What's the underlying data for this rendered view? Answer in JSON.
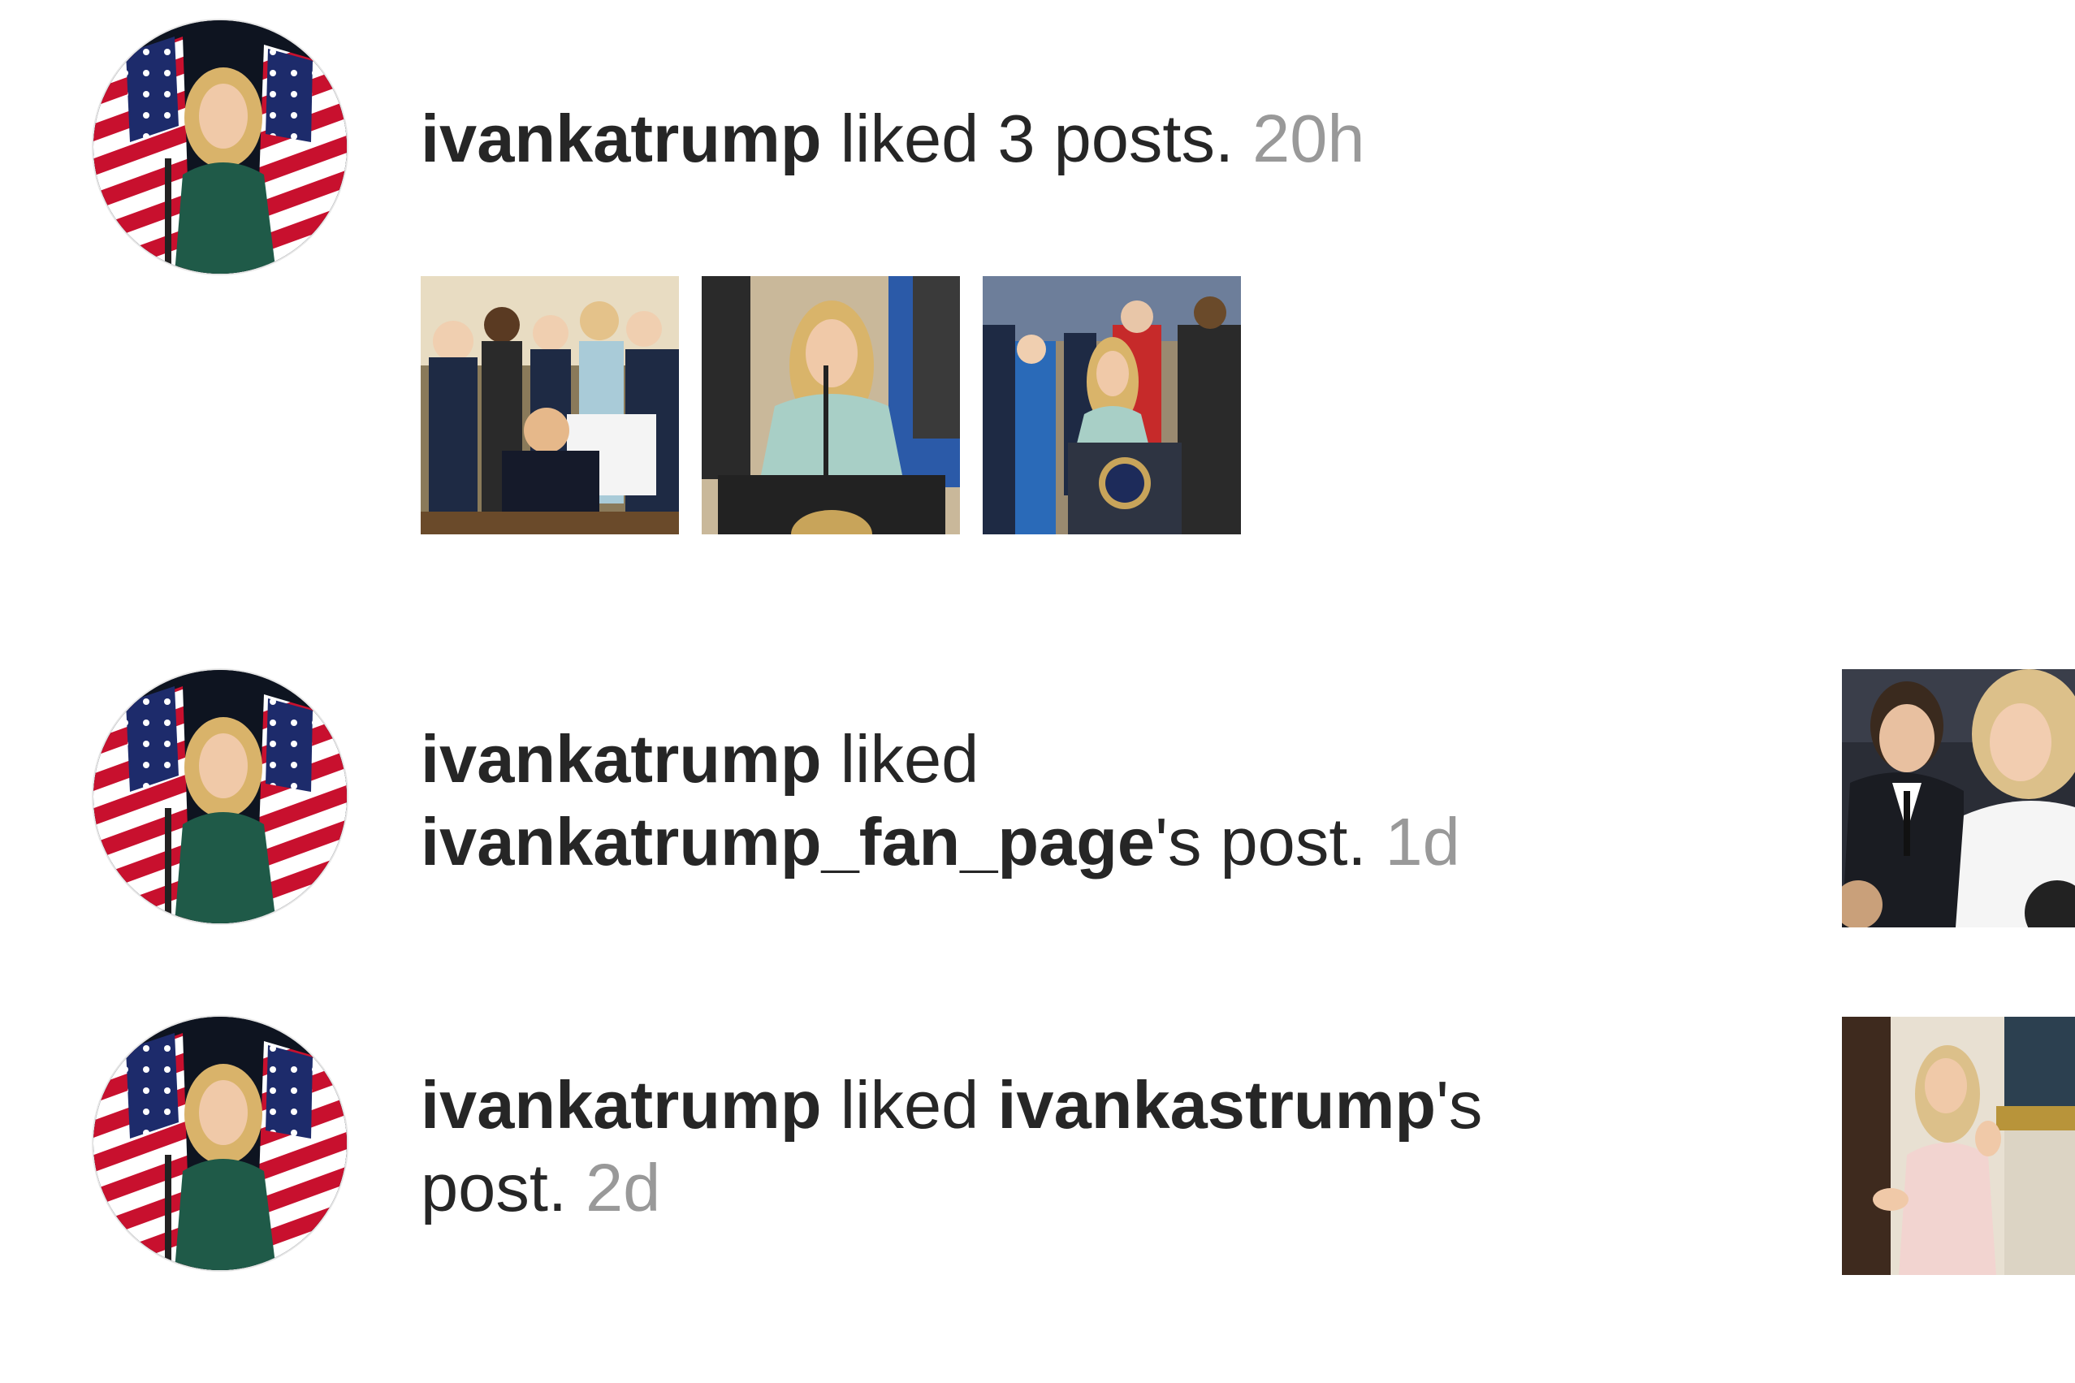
{
  "feed": {
    "items": [
      {
        "username": "ivankatrump",
        "action": " liked 3 posts. ",
        "time": "20h",
        "avatar_icon": "profile-photo",
        "thumbnails": [
          "post-photo",
          "post-photo",
          "post-photo"
        ]
      },
      {
        "username": "ivankatrump",
        "action_line1": " liked",
        "target": "ivankatrump_fan_page",
        "suffix": "'s post. ",
        "time": "1d",
        "avatar_icon": "profile-photo",
        "post_thumbnail": "post-photo"
      },
      {
        "username": "ivankatrump",
        "action": " liked ",
        "target": "ivankastrump",
        "suffix_line1": "'s",
        "suffix_line2": "post. ",
        "time": "2d",
        "avatar_icon": "profile-photo",
        "post_thumbnail": "post-photo"
      }
    ]
  },
  "colors": {
    "text": "#262626",
    "timestamp": "#999999",
    "background": "#ffffff"
  }
}
